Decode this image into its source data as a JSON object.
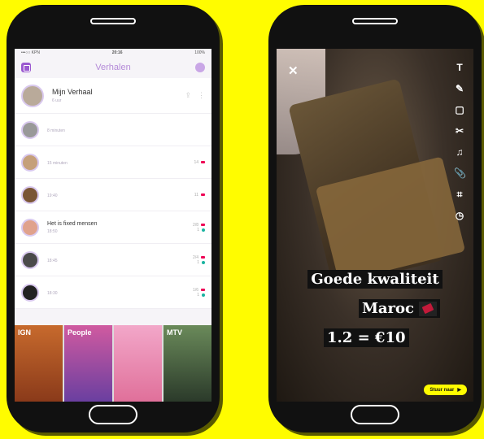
{
  "left_phone": {
    "status": {
      "carrier": "•••○○ KPN",
      "time": "20:16",
      "battery": "100%"
    },
    "title": "Verhalen",
    "my_story": {
      "label": "Mijn Verhaal",
      "sub": "6 uur"
    },
    "stories": [
      {
        "name": "",
        "sub": "8 minuten",
        "count": "",
        "teal": ""
      },
      {
        "name": "",
        "sub": "15 minuten",
        "count": "14",
        "teal": ""
      },
      {
        "name": "",
        "sub": "19:40",
        "count": "11",
        "teal": ""
      },
      {
        "name": "Het is fixed mensen",
        "sub": "18:50",
        "count": "2/8",
        "teal": "1"
      },
      {
        "name": "",
        "sub": "18:45",
        "count": "2/4",
        "teal": "1"
      },
      {
        "name": "",
        "sub": "18:30",
        "count": "1/6",
        "teal": "1"
      }
    ],
    "discover": [
      {
        "label": "IGN",
        "caption": ""
      },
      {
        "label": "People",
        "caption": ""
      },
      {
        "label": "",
        "caption": ""
      },
      {
        "label": "MTV",
        "caption": ""
      }
    ]
  },
  "right_phone": {
    "close": "✕",
    "tools": [
      "T",
      "✎",
      "▢",
      "✂",
      "♫",
      "📎",
      "⌗",
      "◷"
    ],
    "caption_line1": "Goede kwaliteit",
    "caption_line2": "Maroc",
    "caption_line3": "1.2 = €10",
    "send_label": "Stuur naar",
    "send_arrow": "▶"
  },
  "colors": {
    "background": "#FFFC00",
    "accent": "#9b59d0",
    "snap_yellow": "#FFFC00"
  }
}
